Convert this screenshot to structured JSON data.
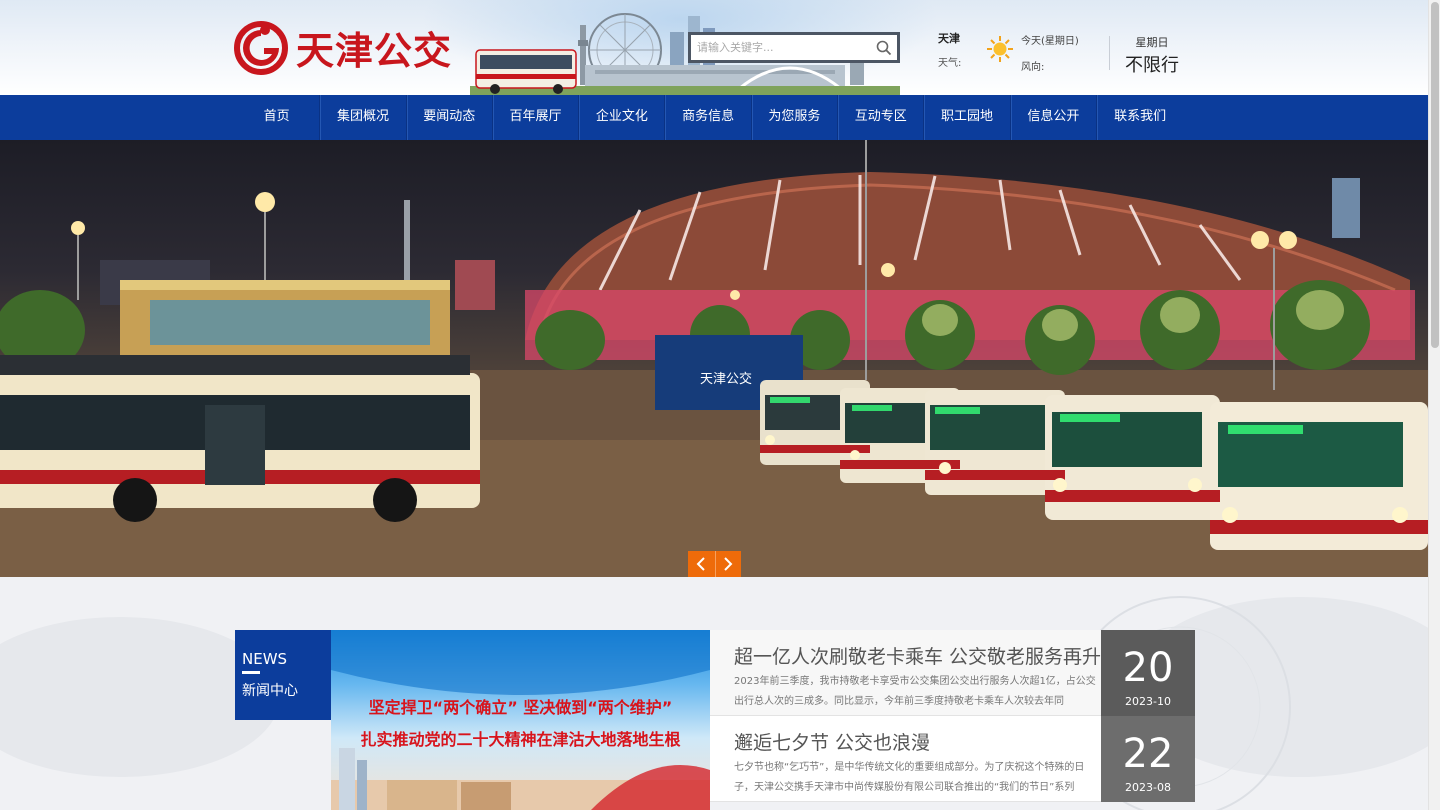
{
  "brand": {
    "name": "天津公交",
    "logo_color": "#c8161d",
    "nav_color": "#0c3d9c",
    "accent": "#ee6b0a"
  },
  "search": {
    "placeholder": "请输入关键字...",
    "icon": "search-icon"
  },
  "weather": {
    "city": "天津",
    "weather_label": "天气:",
    "icon": "sun-icon",
    "today": "今天(星期日)",
    "wind_label": "风向:",
    "weekday": "星期日",
    "restriction": "不限行"
  },
  "nav": {
    "items": [
      {
        "label": "首页"
      },
      {
        "label": "集团概况"
      },
      {
        "label": "要闻动态"
      },
      {
        "label": "百年展厅"
      },
      {
        "label": "企业文化"
      },
      {
        "label": "商务信息"
      },
      {
        "label": "为您服务"
      },
      {
        "label": "互动专区"
      },
      {
        "label": "职工园地"
      },
      {
        "label": "信息公开"
      },
      {
        "label": "联系我们"
      }
    ]
  },
  "banner": {
    "prev_icon": "chevron-left-icon",
    "next_icon": "chevron-right-icon",
    "sign_text": "天津公交"
  },
  "news": {
    "tag_en": "NEWS",
    "tag_zh": "新闻中心",
    "poster_line1": "坚定捍卫“两个确立” 坚决做到“两个维护”",
    "poster_line2": "扎实推动党的二十大精神在津沽大地落地生根",
    "items": [
      {
        "title": "超一亿人次刷敬老卡乘车 公交敬老服务再升级",
        "desc": "2023年前三季度，我市持敬老卡享受市公交集团公交出行服务人次超1亿，占公交出行总人次的三成多。同比显示，今年前三季度持敬老卡乘车人次较去年同",
        "day": "20",
        "ym": "2023-10"
      },
      {
        "title": "邂逅七夕节 公交也浪漫",
        "desc": "七夕节也称“乞巧节”，是中华传统文化的重要组成部分。为了庆祝这个特殊的日子，天津公交携手天津市中尚传媒股份有限公司联合推出的“我们的节日”系列",
        "day": "22",
        "ym": "2023-08"
      }
    ]
  }
}
